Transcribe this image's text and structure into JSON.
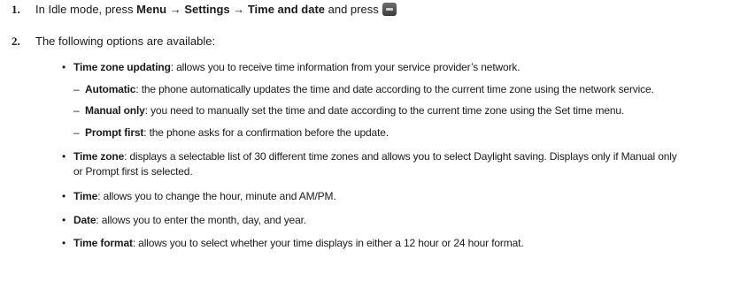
{
  "steps": [
    {
      "number": "1.",
      "pre": "In Idle mode, press ",
      "path": "Menu → Settings → Time and date",
      "post": " and press",
      "key_icon": "ok-key-icon"
    },
    {
      "number": "2.",
      "text": "The following options are available:"
    }
  ],
  "options": [
    {
      "term": "Time zone updating",
      "desc": ": allows you to receive time information from your service provider’s network."
    },
    {
      "term": "Time zone",
      "desc": ": displays a selectable list of 30 different time zones and allows you to select Daylight saving. Displays only if Manual only",
      "desc2": "or Prompt first is selected."
    },
    {
      "term": "Time",
      "desc": ": allows you to change the hour, minute and AM/PM."
    },
    {
      "term": "Date",
      "desc": ": allows you to enter the month, day, and year."
    },
    {
      "term": "Time format",
      "desc": ": allows you to select whether your time displays in either a 12 hour or 24 hour format."
    }
  ],
  "sub_options": [
    {
      "term": "Automatic",
      "desc": ": the phone automatically updates the time and date according to the current time zone using the network service."
    },
    {
      "term": "Manual only",
      "desc": ": you need to manually set the time and date according to the current time zone using the Set time menu."
    },
    {
      "term": "Prompt first",
      "desc": ": the phone asks for a confirmation before the update."
    }
  ],
  "bullet_char": "•",
  "dash_char": "–"
}
